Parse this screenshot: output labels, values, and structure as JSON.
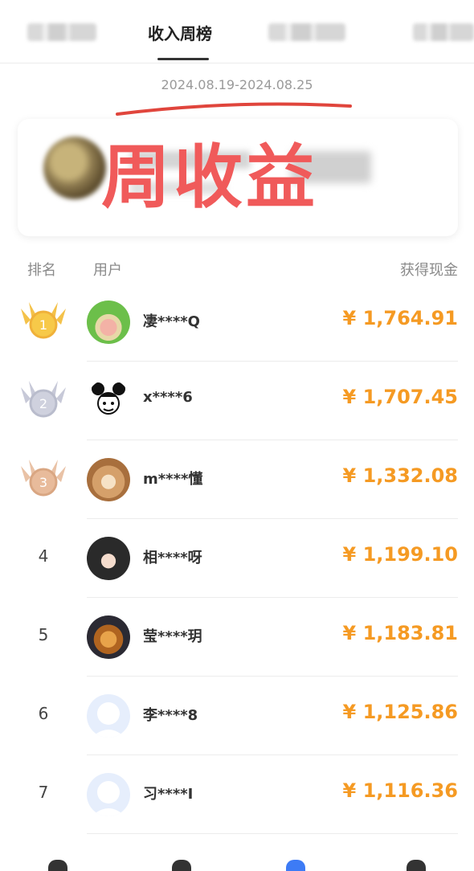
{
  "tabs": {
    "active_label": "收入周榜"
  },
  "date_range": "2024.08.19-2024.08.25",
  "banner": {
    "overlay_text": "周收益"
  },
  "columns": {
    "rank": "排名",
    "user": "用户",
    "earned": "获得现金"
  },
  "accent_color": "#f59a23",
  "rows": [
    {
      "rank": "1",
      "name": "凄****Q",
      "amount": "¥ 1,764.91",
      "avatar": "frog-hat-avatar",
      "medal": "gold-medal"
    },
    {
      "rank": "2",
      "name": "x****6",
      "amount": "¥ 1,707.45",
      "avatar": "cartoon-face-avatar",
      "medal": "silver-medal"
    },
    {
      "rank": "3",
      "name": "m****懂",
      "amount": "¥ 1,332.08",
      "avatar": "shiba-dog-avatar",
      "medal": "bronze-medal"
    },
    {
      "rank": "4",
      "name": "相****呀",
      "amount": "¥ 1,199.10",
      "avatar": "girl-photo-avatar"
    },
    {
      "rank": "5",
      "name": "莹****玥",
      "amount": "¥ 1,183.81",
      "avatar": "cat-photo-avatar"
    },
    {
      "rank": "6",
      "name": "李****8",
      "amount": "¥ 1,125.86",
      "avatar": "default-user-avatar"
    },
    {
      "rank": "7",
      "name": "习****I",
      "amount": "¥ 1,116.36",
      "avatar": "default-user-avatar"
    }
  ]
}
